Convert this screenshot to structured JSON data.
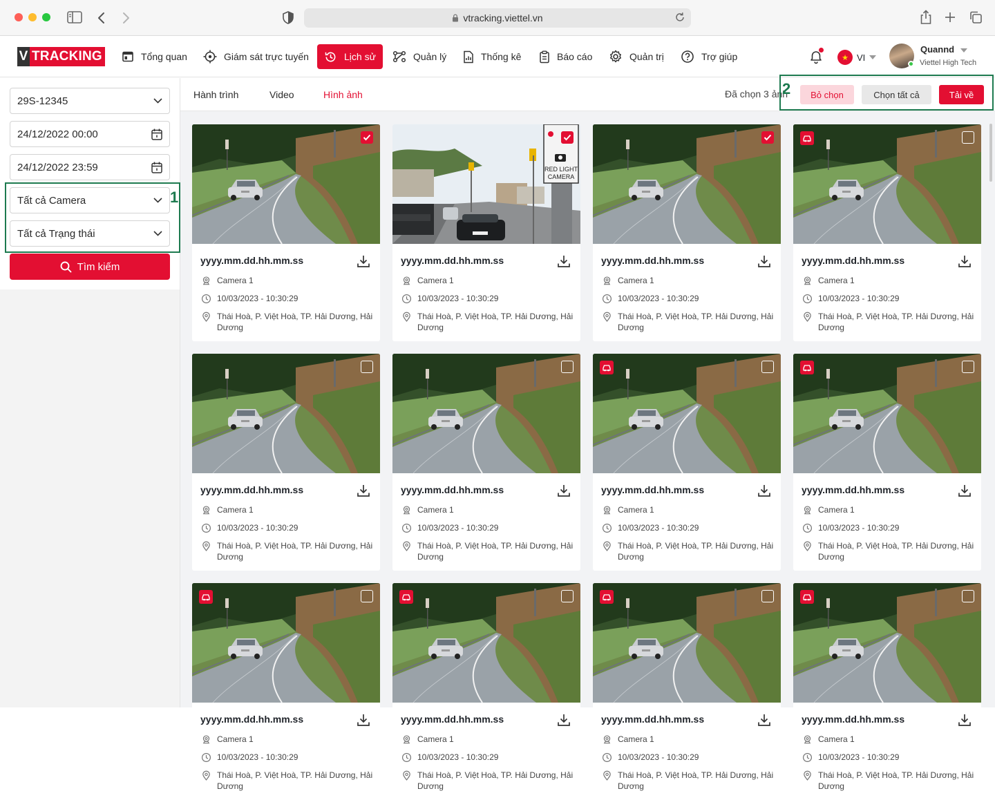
{
  "browser": {
    "url": "vtracking.viettel.vn"
  },
  "app": {
    "logo_v": "V",
    "logo_text": "TRACKING",
    "nav": [
      {
        "label": "Tổng quan",
        "icon": "dashboard-icon"
      },
      {
        "label": "Giám sát trực tuyến",
        "icon": "target-icon"
      },
      {
        "label": "Lịch sử",
        "icon": "history-icon",
        "active": true
      },
      {
        "label": "Quản lý",
        "icon": "manage-icon"
      },
      {
        "label": "Thống kê",
        "icon": "stats-doc-icon"
      },
      {
        "label": "Báo cáo",
        "icon": "clipboard-icon"
      },
      {
        "label": "Quản trị",
        "icon": "gear-icon"
      },
      {
        "label": "Trợ giúp",
        "icon": "help-icon"
      }
    ],
    "lang": "VI",
    "user": {
      "name": "Quannd",
      "company": "Viettel High Tech"
    }
  },
  "filters": {
    "plate": "29S-12345",
    "from": "24/12/2022 00:00",
    "to": "24/12/2022 23:59",
    "camera": "Tất cả Camera",
    "status": "Tất cả Trạng thái",
    "search_label": "Tìm kiếm"
  },
  "annotations": {
    "first": "1",
    "second": "2"
  },
  "tabs": {
    "journey": "Hành trình",
    "video": "Video",
    "images": "Hình ảnh",
    "active": "images"
  },
  "selection": {
    "text": "Đã chọn 3 ảnh",
    "unselect": "Bỏ chọn",
    "select_all": "Chọn tất cả",
    "download": "Tải về"
  },
  "colors": {
    "brand": "#e30f32",
    "annotation": "#1d7a4f"
  },
  "cards": [
    {
      "filename": "yyyy.mm.dd.hh.mm.ss",
      "camera": "Camera 1",
      "time": "10/03/2023 - 10:30:29",
      "location": "Thái Hoà, P. Việt Hoà, TP. Hải Dương, Hải Dương",
      "checked": true,
      "badge": false,
      "image": "road"
    },
    {
      "filename": "yyyy.mm.dd.hh.mm.ss",
      "camera": "Camera 1",
      "time": "10/03/2023 - 10:30:29",
      "location": "Thái Hoà, P. Việt Hoà, TP. Hải Dương, Hải Dương",
      "checked": true,
      "badge": false,
      "image": "street",
      "sign_text": "RED LIGHT CAMERA"
    },
    {
      "filename": "yyyy.mm.dd.hh.mm.ss",
      "camera": "Camera 1",
      "time": "10/03/2023 - 10:30:29",
      "location": "Thái Hoà, P. Việt Hoà, TP. Hải Dương, Hải Dương",
      "checked": true,
      "badge": false,
      "image": "road"
    },
    {
      "filename": "yyyy.mm.dd.hh.mm.ss",
      "camera": "Camera 1",
      "time": "10/03/2023 - 10:30:29",
      "location": "Thái Hoà, P. Việt Hoà, TP. Hải Dương, Hải Dương",
      "checked": false,
      "badge": true,
      "image": "road"
    },
    {
      "filename": "yyyy.mm.dd.hh.mm.ss",
      "camera": "Camera 1",
      "time": "10/03/2023 - 10:30:29",
      "location": "Thái Hoà, P. Việt Hoà, TP. Hải Dương, Hải Dương",
      "checked": false,
      "badge": false,
      "image": "road"
    },
    {
      "filename": "yyyy.mm.dd.hh.mm.ss",
      "camera": "Camera 1",
      "time": "10/03/2023 - 10:30:29",
      "location": "Thái Hoà, P. Việt Hoà, TP. Hải Dương, Hải Dương",
      "checked": false,
      "badge": false,
      "image": "road"
    },
    {
      "filename": "yyyy.mm.dd.hh.mm.ss",
      "camera": "Camera 1",
      "time": "10/03/2023 - 10:30:29",
      "location": "Thái Hoà, P. Việt Hoà, TP. Hải Dương, Hải Dương",
      "checked": false,
      "badge": true,
      "image": "road"
    },
    {
      "filename": "yyyy.mm.dd.hh.mm.ss",
      "camera": "Camera 1",
      "time": "10/03/2023 - 10:30:29",
      "location": "Thái Hoà, P. Việt Hoà, TP. Hải Dương, Hải Dương",
      "checked": false,
      "badge": true,
      "image": "road"
    },
    {
      "filename": "yyyy.mm.dd.hh.mm.ss",
      "camera": "Camera 1",
      "time": "10/03/2023 - 10:30:29",
      "location": "Thái Hoà, P. Việt Hoà, TP. Hải Dương, Hải Dương",
      "checked": false,
      "badge": true,
      "image": "road"
    },
    {
      "filename": "yyyy.mm.dd.hh.mm.ss",
      "camera": "Camera 1",
      "time": "10/03/2023 - 10:30:29",
      "location": "Thái Hoà, P. Việt Hoà, TP. Hải Dương, Hải Dương",
      "checked": false,
      "badge": true,
      "image": "road"
    },
    {
      "filename": "yyyy.mm.dd.hh.mm.ss",
      "camera": "Camera 1",
      "time": "10/03/2023 - 10:30:29",
      "location": "Thái Hoà, P. Việt Hoà, TP. Hải Dương, Hải Dương",
      "checked": false,
      "badge": true,
      "image": "road"
    },
    {
      "filename": "yyyy.mm.dd.hh.mm.ss",
      "camera": "Camera 1",
      "time": "10/03/2023 - 10:30:29",
      "location": "Thái Hoà, P. Việt Hoà, TP. Hải Dương, Hải Dương",
      "checked": false,
      "badge": true,
      "image": "road"
    }
  ]
}
